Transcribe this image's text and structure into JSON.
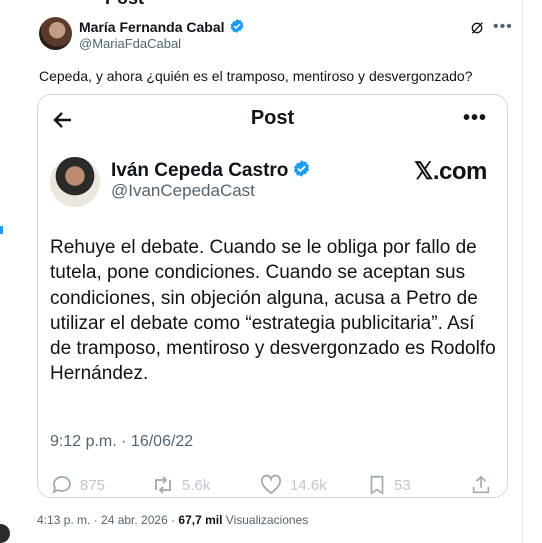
{
  "top": {
    "cut_title": "Post"
  },
  "author": {
    "name": "María Fernanda Cabal",
    "handle": "@MariaFdaCabal"
  },
  "tweet": {
    "text": "Cepeda, y ahora ¿quién es el tramposo, mentiroso y desvergonzado?"
  },
  "embed": {
    "header": "Post",
    "name": "Iván Cepeda Castro",
    "handle": "@IvanCepedaCast",
    "logo": "𝕏.com",
    "body": "Rehuye el debate. Cuando se le obliga por fallo de tutela, pone condiciones. Cuando se aceptan sus condiciones, sin objeción alguna, acusa a Petro de utilizar el debate como “estrategia publicitaria”. Así de tramposo, mentiroso y desvergonzado es Rodolfo Hernández.",
    "time": "9:12 p.m. · 16/06/22",
    "actions": {
      "replies": "875",
      "reposts": "5.6k",
      "likes": "14.6k",
      "bookmarks": "53"
    }
  },
  "meta": {
    "timestamp": "4:13 p. m. · 24 abr. 2026 · ",
    "views_count": "67,7 mil",
    "views_label": " Visualizaciones"
  },
  "colors": {
    "verified": "#1d9bf0",
    "secondary_text": "#536471",
    "border": "#cfd9de"
  },
  "icons": [
    "verified-badge-icon",
    "grok-icon",
    "more-icon",
    "back-arrow-icon",
    "reply-icon",
    "repost-icon",
    "like-icon",
    "bookmark-icon",
    "share-icon"
  ]
}
